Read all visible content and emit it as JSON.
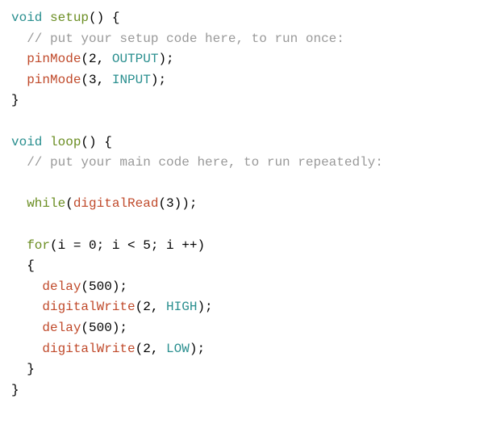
{
  "code": {
    "l01_void": "void",
    "l01_setup": "setup",
    "l01_rest": "() {",
    "l02_comment": "// put your setup code here, to run once:",
    "l03_pinMode": "pinMode",
    "l03_args_open": "(",
    "l03_arg1": "2",
    "l03_comma": ", ",
    "l03_OUTPUT": "OUTPUT",
    "l03_close": ");",
    "l04_pinMode": "pinMode",
    "l04_args_open": "(",
    "l04_arg1": "3",
    "l04_comma": ", ",
    "l04_INPUT": "INPUT",
    "l04_close": ");",
    "l05_brace": "}",
    "l07_void": "void",
    "l07_loop": "loop",
    "l07_rest": "() {",
    "l08_comment": "// put your main code here, to run repeatedly:",
    "l10_while": "while",
    "l10_open": "(",
    "l10_digitalRead": "digitalRead",
    "l10_args": "(3));",
    "l12_for": "for",
    "l12_open": "(i = 0; i < 5; i ++)",
    "l13_brace": "{",
    "l14_delay": "delay",
    "l14_args": "(500);",
    "l15_digitalWrite": "digitalWrite",
    "l15_open": "(",
    "l15_arg1": "2",
    "l15_comma": ", ",
    "l15_HIGH": "HIGH",
    "l15_close": ");",
    "l16_delay": "delay",
    "l16_args": "(500);",
    "l17_digitalWrite": "digitalWrite",
    "l17_open": "(",
    "l17_arg1": "2",
    "l17_comma": ", ",
    "l17_LOW": "LOW",
    "l17_close": ");",
    "l18_brace": "}",
    "l19_brace": "}"
  }
}
